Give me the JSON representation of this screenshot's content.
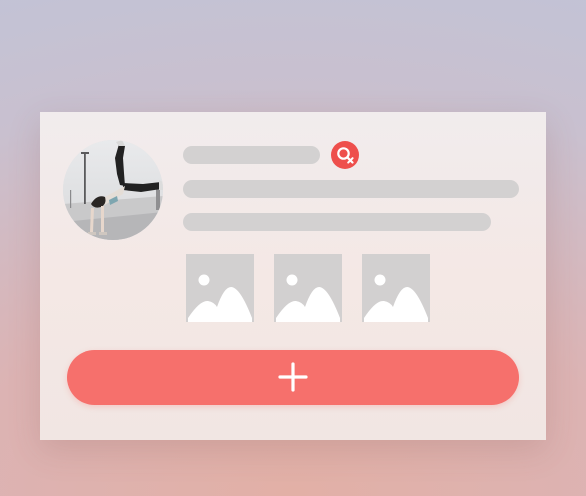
{
  "card": {
    "avatar": {
      "icon": "profile-photo"
    },
    "badge": {
      "icon": "gender-symbol-icon",
      "color": "#ee4f4c"
    },
    "gallery": [
      {
        "icon": "image-placeholder-icon"
      },
      {
        "icon": "image-placeholder-icon"
      },
      {
        "icon": "image-placeholder-icon"
      }
    ],
    "add_button": {
      "icon": "plus-icon",
      "color": "#f6706c"
    }
  },
  "colors": {
    "skeleton": "#d3d1d1",
    "card_background": "#f2e9e7"
  }
}
